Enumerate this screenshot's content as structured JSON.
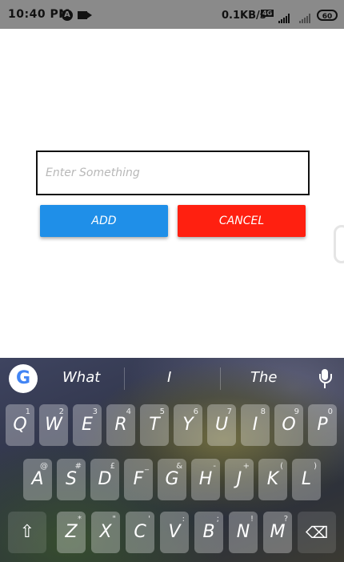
{
  "status_bar": {
    "time": "10:40 PM",
    "network_speed": "0.1KB/s",
    "volte_label": "VoLTE",
    "battery": "60",
    "notification_icon": "a-icon"
  },
  "form": {
    "input_placeholder": "Enter Something",
    "input_value": "",
    "add_label": "ADD",
    "cancel_label": "CANCEL"
  },
  "colors": {
    "add_button": "#1f8fe8",
    "cancel_button": "#ff2010"
  },
  "keyboard": {
    "suggestions": [
      "What",
      "I",
      "The"
    ],
    "row1": [
      {
        "key": "Q",
        "hint": "1"
      },
      {
        "key": "W",
        "hint": "2"
      },
      {
        "key": "E",
        "hint": "3"
      },
      {
        "key": "R",
        "hint": "4"
      },
      {
        "key": "T",
        "hint": "5"
      },
      {
        "key": "Y",
        "hint": "6"
      },
      {
        "key": "U",
        "hint": "7"
      },
      {
        "key": "I",
        "hint": "8"
      },
      {
        "key": "O",
        "hint": "9"
      },
      {
        "key": "P",
        "hint": "0"
      }
    ],
    "row2": [
      {
        "key": "A",
        "hint": "@"
      },
      {
        "key": "S",
        "hint": "#"
      },
      {
        "key": "D",
        "hint": "£"
      },
      {
        "key": "F",
        "hint": "_"
      },
      {
        "key": "G",
        "hint": "&"
      },
      {
        "key": "H",
        "hint": "-"
      },
      {
        "key": "J",
        "hint": "+"
      },
      {
        "key": "K",
        "hint": "("
      },
      {
        "key": "L",
        "hint": ")"
      }
    ],
    "row3": [
      {
        "key": "Z",
        "hint": "*"
      },
      {
        "key": "X",
        "hint": "\""
      },
      {
        "key": "C",
        "hint": "'"
      },
      {
        "key": "V",
        "hint": ":"
      },
      {
        "key": "B",
        "hint": ";"
      },
      {
        "key": "N",
        "hint": "!"
      },
      {
        "key": "M",
        "hint": "?"
      }
    ],
    "shift_icon": "shift-icon",
    "backspace_icon": "backspace-icon"
  }
}
